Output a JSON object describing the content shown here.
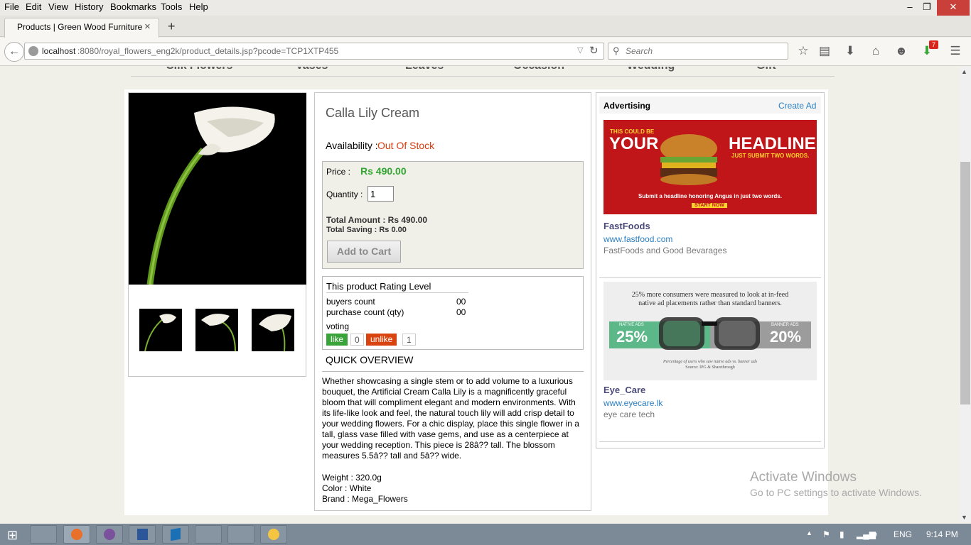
{
  "menu": {
    "file": "File",
    "edit": "Edit",
    "view": "View",
    "history": "History",
    "bookmarks": "Bookmarks",
    "tools": "Tools",
    "help": "Help"
  },
  "tab": {
    "title": "Products | Green Wood Furniture",
    "close": "×",
    "new": "+"
  },
  "nav": {
    "url_host": "localhost",
    "url_rest": ":8080/royal_flowers_eng2k/product_details.jsp?pcode=TCP1XTP455",
    "search_placeholder": "Search",
    "notif_count": "7"
  },
  "categories": [
    "Silk Flowers",
    "Vases",
    "Leaves",
    "Occasion",
    "Wedding",
    "Gift"
  ],
  "product": {
    "name": "Calla Lily Cream",
    "availability_label": "Availability :",
    "availability_value": "Out Of Stock",
    "price_label": "Price :",
    "price_value": "Rs 490.00",
    "quantity_label": "Quantity :",
    "quantity_value": "1",
    "total_amount": "Total Amount : Rs 490.00",
    "total_saving": "Total Saving : Rs 0.00",
    "add_to_cart": "Add to Cart"
  },
  "rating": {
    "title": "This product Rating Level",
    "buyers_label": "buyers count",
    "buyers_value": "00",
    "purchase_label": "purchase count (qty)",
    "purchase_value": "00",
    "voting_label": "voting",
    "like_label": "like",
    "like_count": "0",
    "unlike_label": "unlike",
    "unlike_count": "1"
  },
  "overview": {
    "title": "QUICK OVERVIEW",
    "description": "Whether showcasing a single stem or to add volume to a luxurious bouquet, the Artificial Cream Calla Lily is a magnificently graceful bloom that will compliment elegant and modern environments. With its life-like look and feel, the natural touch lily will add crisp detail to your wedding flowers. For a chic display, place this single flower in a tall, glass vase filled with vase gems, and use as a centerpiece at your wedding reception. This piece is 28â?? tall. The blossom measures 5.5â?? tall and 5â?? wide.",
    "weight": "Weight : 320.0g",
    "color": "Color : White",
    "brand": "Brand : Mega_Flowers"
  },
  "ads": {
    "header": "Advertising",
    "create": "Create Ad",
    "ad1": {
      "name": "FastFoods",
      "url": "www.fastfood.com",
      "desc": "FastFoods and Good Bevarages",
      "banner_small": "THIS COULD BE",
      "banner_your": "YOUR",
      "banner_headline": "HEADLINE.",
      "banner_sub": "JUST SUBMIT TWO WORDS.",
      "banner_note": "Submit a headline honoring Angus in just two words.",
      "banner_cta": "START NOW"
    },
    "ad2": {
      "name": "Eye_Care",
      "url": "www.eyecare.lk",
      "desc": "eye care tech",
      "banner_line1": "25% more consumers were measured to look at in-feed",
      "banner_line2": "native ad placements rather than standard banners.",
      "native_label": "NATIVE ADS",
      "native_value": "25%",
      "banner_label": "BANNER ADS",
      "banner_value": "20%",
      "footnote1": "Percentage of users who saw native ads vs. banner ads",
      "footnote2": "Source: IPG & Sharethrough"
    }
  },
  "watermark": {
    "line1": "Activate Windows",
    "line2": "Go to PC settings to activate Windows."
  },
  "taskbar": {
    "lang": "ENG",
    "time": "9:14 PM"
  }
}
